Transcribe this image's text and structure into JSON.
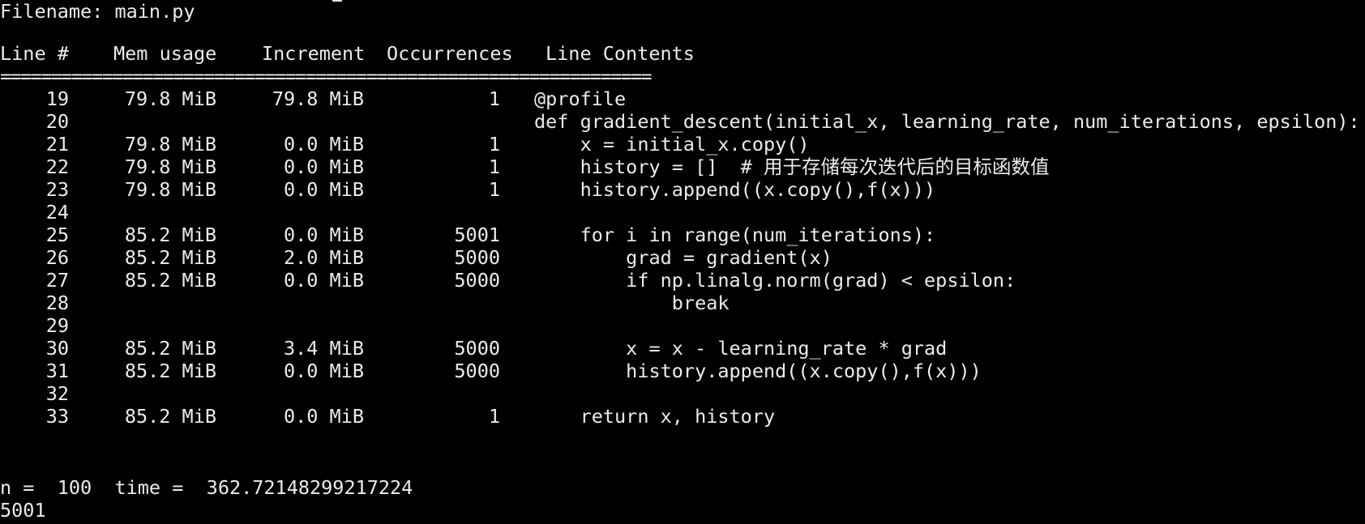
{
  "terminal": {
    "filename_line": "Filename: main.py",
    "header": {
      "line_no": "Line #",
      "mem_usage": "Mem usage",
      "increment": "Increment",
      "occurrences": "Occurrences",
      "line_contents": "Line Contents"
    },
    "separator": "================================================================",
    "rows": [
      {
        "line_no": "19",
        "mem": "79.8 MiB",
        "inc": "79.8 MiB",
        "occ": "1",
        "code": "@profile"
      },
      {
        "line_no": "20",
        "mem": "",
        "inc": "",
        "occ": "",
        "code": "def gradient_descent(initial_x, learning_rate, num_iterations, epsilon):"
      },
      {
        "line_no": "21",
        "mem": "79.8 MiB",
        "inc": "0.0 MiB",
        "occ": "1",
        "code": "    x = initial_x.copy()"
      },
      {
        "line_no": "22",
        "mem": "79.8 MiB",
        "inc": "0.0 MiB",
        "occ": "1",
        "code": "    history = []  # 用于存储每次迭代后的目标函数值"
      },
      {
        "line_no": "23",
        "mem": "79.8 MiB",
        "inc": "0.0 MiB",
        "occ": "1",
        "code": "    history.append((x.copy(),f(x)))"
      },
      {
        "line_no": "24",
        "mem": "",
        "inc": "",
        "occ": "",
        "code": ""
      },
      {
        "line_no": "25",
        "mem": "85.2 MiB",
        "inc": "0.0 MiB",
        "occ": "5001",
        "code": "    for i in range(num_iterations):"
      },
      {
        "line_no": "26",
        "mem": "85.2 MiB",
        "inc": "2.0 MiB",
        "occ": "5000",
        "code": "        grad = gradient(x)"
      },
      {
        "line_no": "27",
        "mem": "85.2 MiB",
        "inc": "0.0 MiB",
        "occ": "5000",
        "code": "        if np.linalg.norm(grad) < epsilon:"
      },
      {
        "line_no": "28",
        "mem": "",
        "inc": "",
        "occ": "",
        "code": "            break"
      },
      {
        "line_no": "29",
        "mem": "",
        "inc": "",
        "occ": "",
        "code": ""
      },
      {
        "line_no": "30",
        "mem": "85.2 MiB",
        "inc": "3.4 MiB",
        "occ": "5000",
        "code": "        x = x - learning_rate * grad"
      },
      {
        "line_no": "31",
        "mem": "85.2 MiB",
        "inc": "0.0 MiB",
        "occ": "5000",
        "code": "        history.append((x.copy(),f(x)))"
      },
      {
        "line_no": "32",
        "mem": "",
        "inc": "",
        "occ": "",
        "code": ""
      },
      {
        "line_no": "33",
        "mem": "85.2 MiB",
        "inc": "0.0 MiB",
        "occ": "1",
        "code": "    return x, history"
      }
    ],
    "result_line": "n =  100  time =  362.72148299217224",
    "count_line": "5001"
  }
}
